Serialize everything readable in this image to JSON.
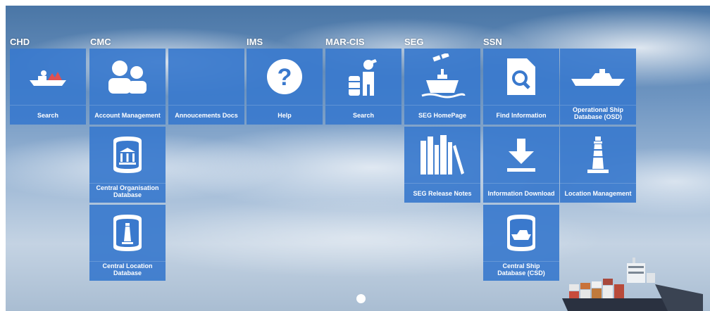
{
  "groups": {
    "chd": "CHD",
    "cmc": "CMC",
    "ims": "IMS",
    "marcis": "MAR-CIS",
    "seg": "SEG",
    "ssn": "SSN"
  },
  "tiles": {
    "chd_search": "Search",
    "account_management": "Account Management",
    "announcements_docs": "Annoucements Docs",
    "help": "Help",
    "marcis_search": "Search",
    "seg_homepage": "SEG HomePage",
    "find_information": "Find Information",
    "osd": "Operational Ship\nDatabase (OSD)",
    "central_org_db": "Central Organisation\nDatabase",
    "seg_release_notes": "SEG Release Notes",
    "information_download": "Information Download",
    "location_management": "Location Management",
    "central_location_db": "Central Location\nDatabase",
    "csd": "Central Ship\nDatabase (CSD)"
  },
  "colors": {
    "tile": "#3a79cd",
    "icon": "#ffffff"
  },
  "carousel": {
    "slides_visible": 1
  }
}
